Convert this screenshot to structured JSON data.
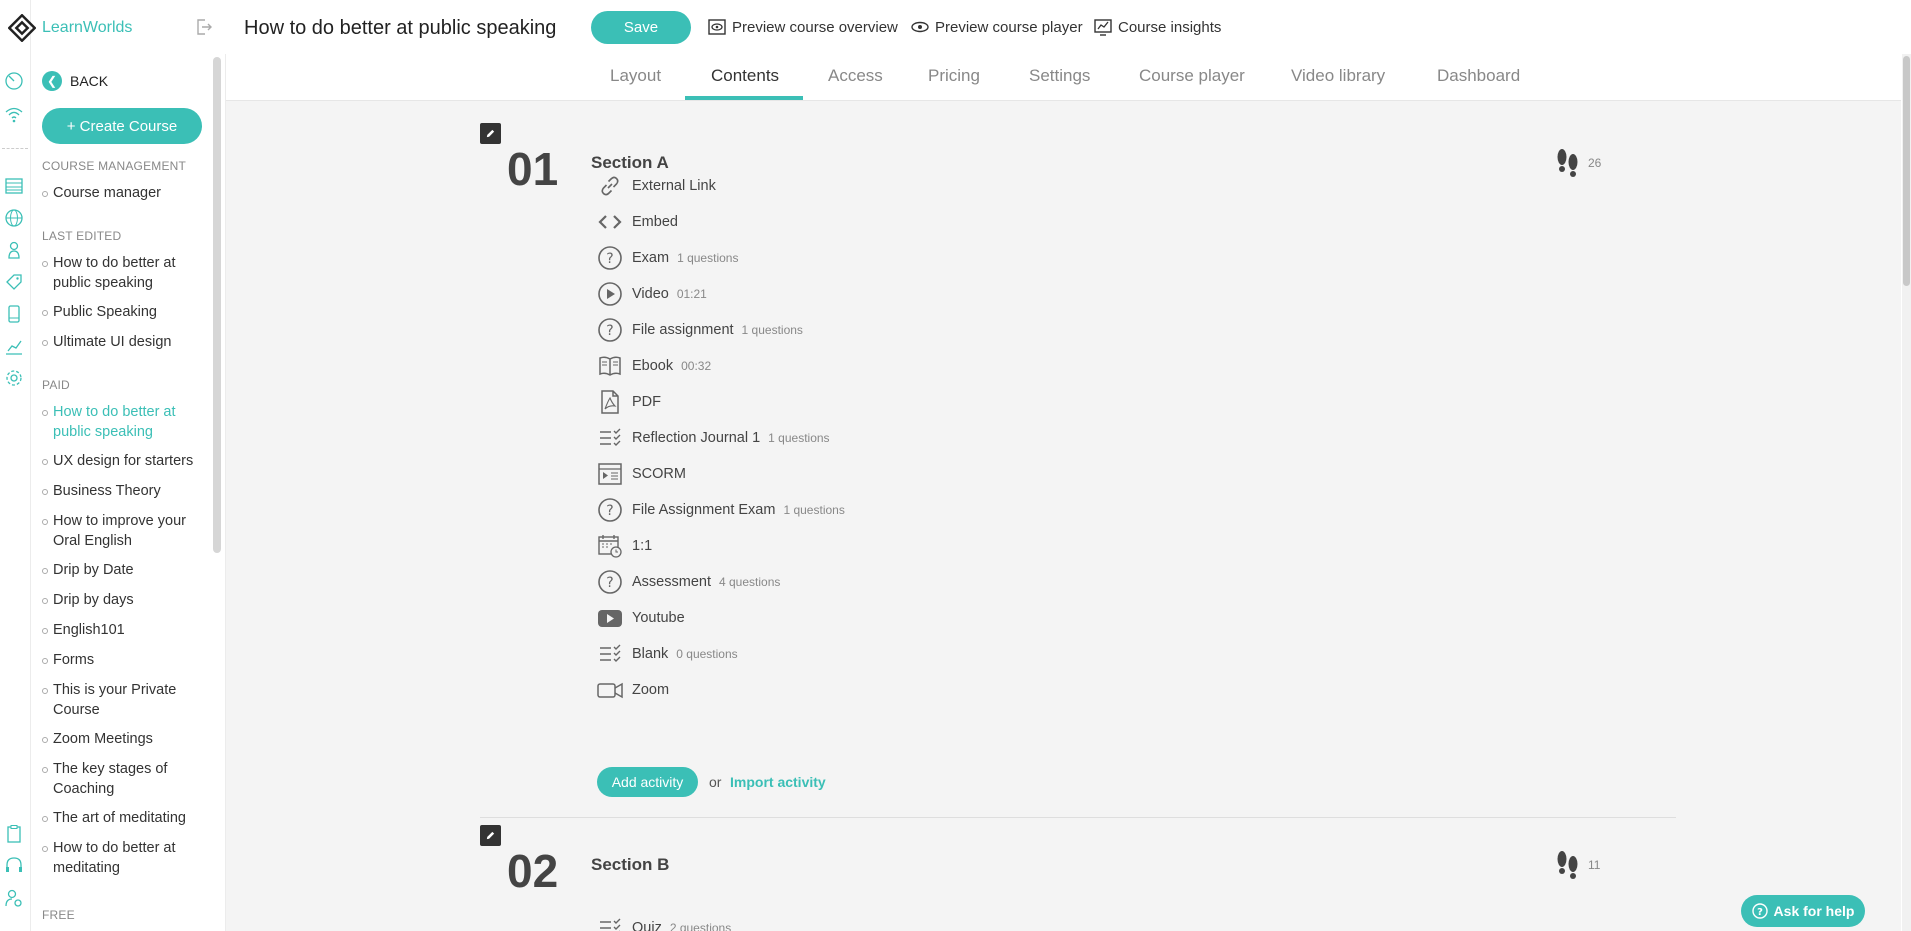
{
  "app": {
    "brand": "LearnWorlds",
    "accent": "#3bbfb6"
  },
  "header": {
    "title": "How to do better at public speaking",
    "save_label": "Save",
    "links": [
      "Preview course overview",
      "Preview course player",
      "Course insights"
    ]
  },
  "tabs": [
    "Layout",
    "Contents",
    "Access",
    "Pricing",
    "Settings",
    "Course player",
    "Video library",
    "Dashboard"
  ],
  "active_tab": "Contents",
  "sidebar": {
    "back_label": "BACK",
    "create_label": "+ Create Course",
    "cat_management": "COURSE MANAGEMENT",
    "cat_last_edited": "LAST EDITED",
    "cat_paid": "PAID",
    "cat_free": "FREE",
    "course_manager": "Course manager",
    "last_edited": [
      "How to do better at public speaking",
      "Public Speaking",
      "Ultimate UI design"
    ],
    "paid": [
      "How to do better at public speaking",
      "UX design for starters",
      "Business Theory",
      "How to improve your Oral English",
      "Drip by Date",
      "Drip by days",
      "English101",
      "Forms",
      "This is your Private Course",
      "Zoom Meetings",
      "The key stages of Coaching",
      "The art of meditating",
      "How to do better at meditating"
    ]
  },
  "sections": [
    {
      "number": "01",
      "title": "Section A",
      "steps": "26",
      "activities": [
        {
          "icon": "link-icon",
          "label": "External Link",
          "meta": ""
        },
        {
          "icon": "code-icon",
          "label": "Embed",
          "meta": ""
        },
        {
          "icon": "question-icon",
          "label": "Exam",
          "meta": "1 questions"
        },
        {
          "icon": "play-icon",
          "label": "Video",
          "meta": "01:21"
        },
        {
          "icon": "question-icon",
          "label": "File assignment",
          "meta": "1 questions"
        },
        {
          "icon": "book-icon",
          "label": "Ebook",
          "meta": "00:32"
        },
        {
          "icon": "pdf-icon",
          "label": "PDF",
          "meta": ""
        },
        {
          "icon": "checklist-icon",
          "label": "Reflection Journal 1",
          "meta": "1 questions"
        },
        {
          "icon": "scorm-icon",
          "label": "SCORM",
          "meta": ""
        },
        {
          "icon": "question-icon",
          "label": "File Assignment Exam",
          "meta": "1 questions"
        },
        {
          "icon": "calendar-clock-icon",
          "label": "1:1",
          "meta": ""
        },
        {
          "icon": "question-icon",
          "label": "Assessment",
          "meta": "4 questions"
        },
        {
          "icon": "youtube-icon",
          "label": "Youtube",
          "meta": ""
        },
        {
          "icon": "checklist-icon",
          "label": "Blank",
          "meta": "0 questions"
        },
        {
          "icon": "camera-icon",
          "label": "Zoom",
          "meta": ""
        }
      ],
      "add_label": "Add activity",
      "or_label": "or",
      "import_label": "Import activity"
    },
    {
      "number": "02",
      "title": "Section B",
      "steps": "11",
      "activities": [
        {
          "icon": "checklist-icon",
          "label": "Quiz",
          "meta": "2 questions"
        }
      ]
    }
  ],
  "help_label": "Ask for help"
}
